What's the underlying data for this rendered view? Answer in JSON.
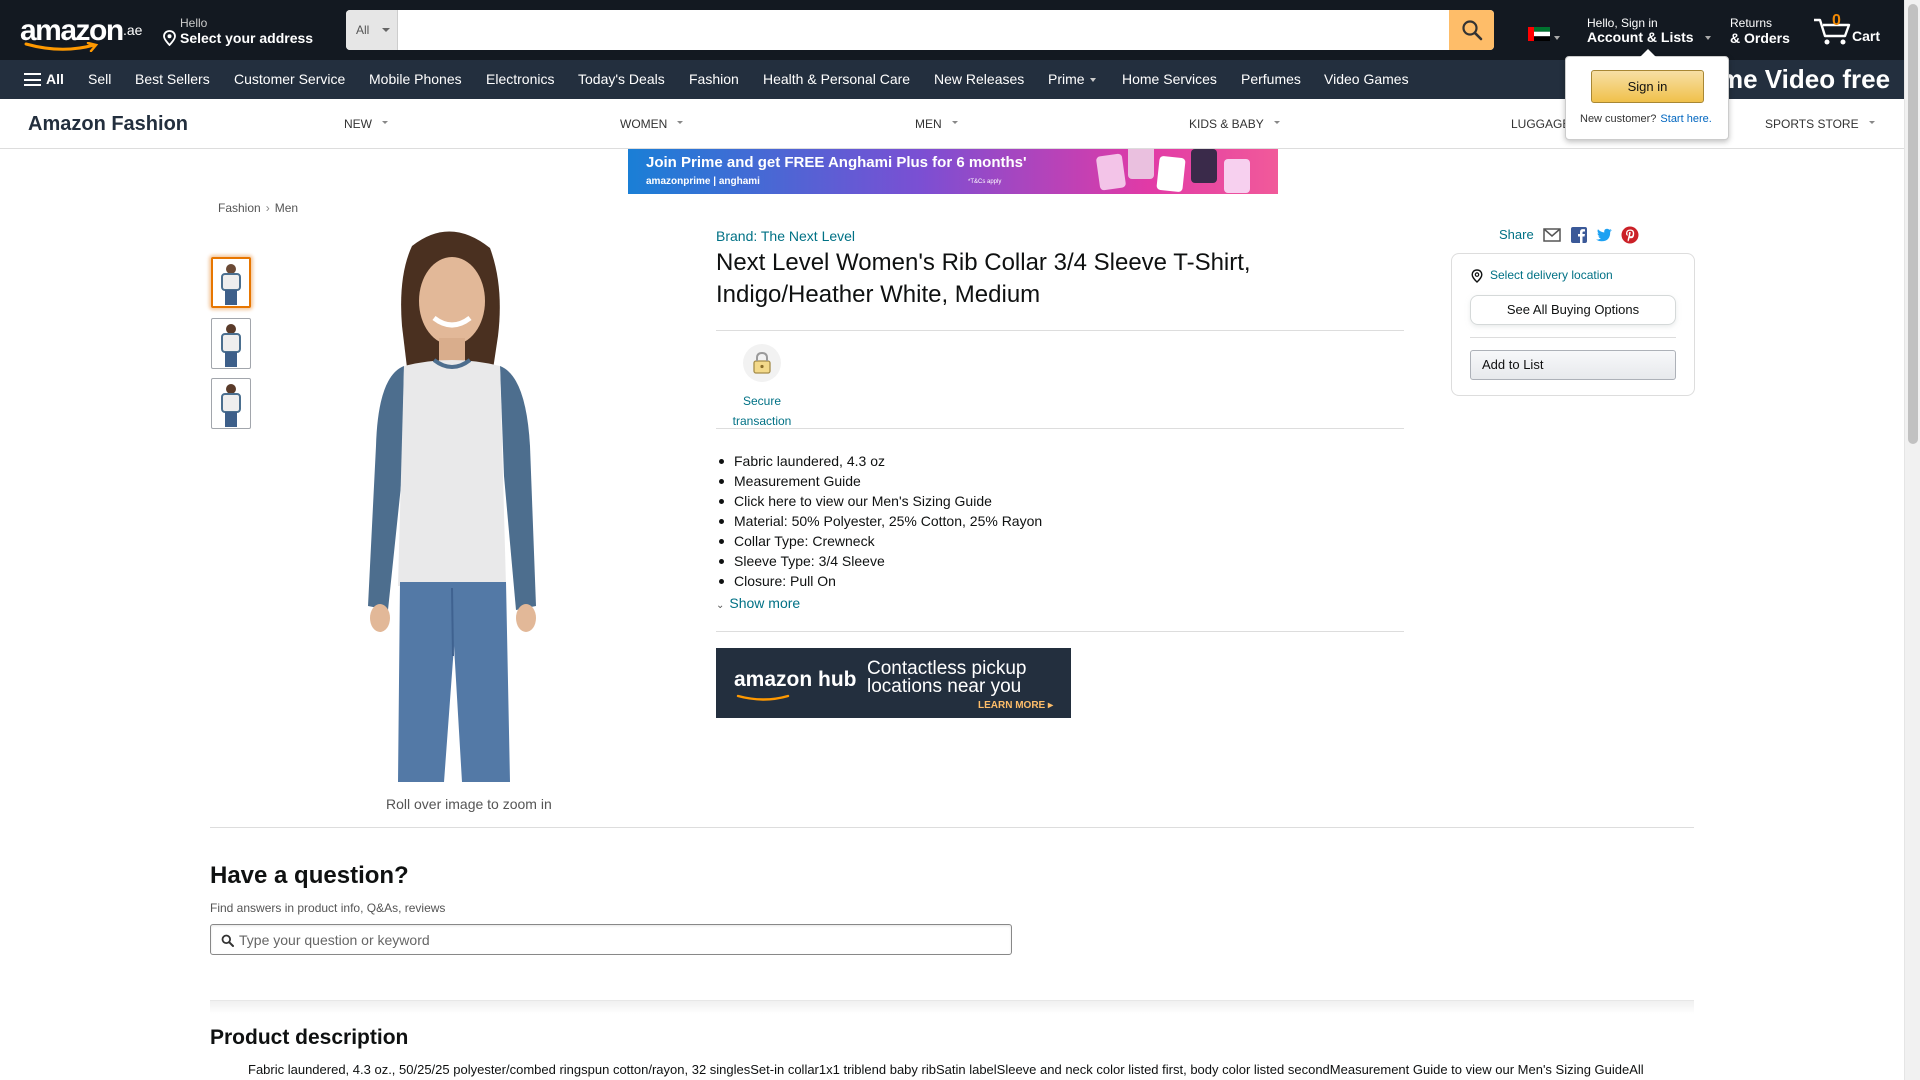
{
  "header": {
    "logo_text": "amazon",
    "logo_tld": ".ae",
    "deliver_line1": "Hello",
    "deliver_line2": "Select your address",
    "search_category": "All",
    "search_placeholder": "",
    "account_line1": "Hello, Sign in",
    "account_line2": "Account & Lists",
    "returns_line1": "Returns",
    "returns_line2": "& Orders",
    "cart_count": "0",
    "cart_label": "Cart"
  },
  "subnav": {
    "all_label": "All",
    "items": [
      "Sell",
      "Best Sellers",
      "Customer Service",
      "Mobile Phones",
      "Electronics",
      "Today's Deals",
      "Fashion",
      "Health & Personal Care",
      "New Releases",
      "Prime",
      "Home Services",
      "Perfumes",
      "Video Games"
    ],
    "promo_text": "me Video free"
  },
  "signin_flyout": {
    "button_label": "Sign in",
    "new_customer": "New customer?",
    "start_here": "Start here."
  },
  "store": {
    "brand": "Amazon Fashion",
    "categories": [
      "NEW",
      "WOMEN",
      "MEN",
      "KIDS & BABY",
      "LUGGAGE",
      "SPORTS STORE"
    ]
  },
  "banner": {
    "headline": "Join Prime and get FREE Anghami Plus for 6 months'",
    "brands": "amazonprime  |  anghami",
    "fine_print": "*T&Cs apply"
  },
  "breadcrumb": [
    "Fashion",
    "Men"
  ],
  "gallery": {
    "zoom_hint": "Roll over image to zoom in"
  },
  "product": {
    "brand_link": "Brand: The Next Level",
    "title": "Next Level Women's Rib Collar 3/4 Sleeve T-Shirt, Indigo/Heather White, Medium",
    "secure_label": "Secure transaction",
    "bullets": [
      "Fabric laundered, 4.3 oz",
      "Measurement Guide",
      "Click here to view our Men's Sizing Guide",
      "Material: 50% Polyester, 25% Cotton, 25% Rayon",
      "Collar Type: Crewneck",
      "Sleeve Type: 3/4 Sleeve",
      "Closure: Pull On"
    ],
    "show_more": "Show more"
  },
  "hub_ad": {
    "logo": "amazon hub",
    "message_line1": "Contactless pickup",
    "message_line2": "locations near you",
    "cta": "LEARN MORE ▸"
  },
  "buybox": {
    "share_label": "Share",
    "delivery_location": "Select delivery location",
    "see_all_options": "See All Buying Options",
    "add_to_list": "Add to List"
  },
  "questions": {
    "title": "Have a question?",
    "subtitle": "Find answers in product info, Q&As, reviews",
    "placeholder": "Type your question or keyword"
  },
  "description": {
    "title": "Product description",
    "text": "Fabric laundered, 4.3 oz., 50/25/25 polyester/combed ringspun cotton/rayon, 32 singlesSet-in collar1x1 triblend baby ribSatin labelSleeve and neck color listed first, body color listed secondMeasurement Guide to view our Men's Sizing GuideAll"
  },
  "colors": {
    "nav_dark": "#131921",
    "nav_secondary": "#232f3e",
    "search_button": "#febd69",
    "link": "#007185",
    "cart_count": "#f08804",
    "thumb_selected": "#e77600"
  }
}
